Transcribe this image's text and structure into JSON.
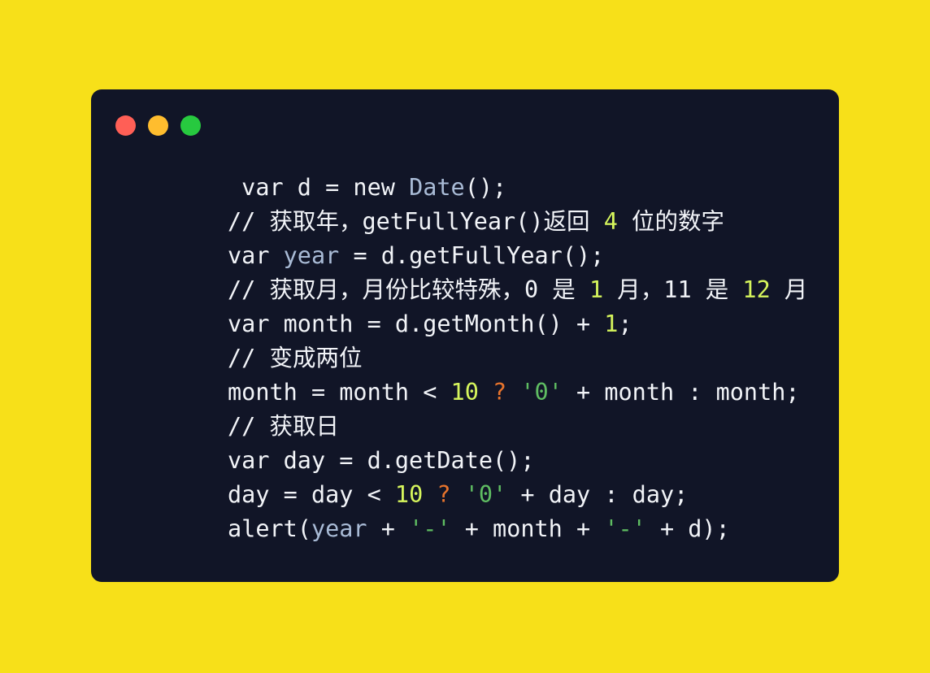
{
  "theme": {
    "page_background": "#f7e019",
    "card_background": "#111527",
    "text_default": "#f2f4f8",
    "color_type": "#a9bbd6",
    "color_variable": "#a9bbd6",
    "color_number": "#d6f55c",
    "color_string": "#5fbd62",
    "color_operator": "#e8742c",
    "color_comment": "#f2f4f8",
    "dot_close": "#ff5f56",
    "dot_minimize": "#ffbd2e",
    "dot_maximize": "#27c93f"
  },
  "window": {
    "controls": [
      {
        "name": "close",
        "color": "#ff5f56"
      },
      {
        "name": "minimize",
        "color": "#ffbd2e"
      },
      {
        "name": "maximize",
        "color": "#27c93f"
      }
    ]
  },
  "code": {
    "language": "javascript",
    "lines": [
      {
        "index": 1,
        "text": " var d = new Date();",
        "tokens": [
          {
            "t": " var d = new ",
            "c": "plain"
          },
          {
            "t": "Date",
            "c": "type"
          },
          {
            "t": "();",
            "c": "plain"
          }
        ]
      },
      {
        "index": 2,
        "text": "// 获取年，getFullYear()返回 4 位的数字",
        "tokens": [
          {
            "t": "// 获取年，getFullYear()返回 ",
            "c": "comment"
          },
          {
            "t": "4",
            "c": "number"
          },
          {
            "t": " 位的数字",
            "c": "comment"
          }
        ]
      },
      {
        "index": 3,
        "text": "var year = d.getFullYear();",
        "tokens": [
          {
            "t": "var ",
            "c": "plain"
          },
          {
            "t": "year",
            "c": "var"
          },
          {
            "t": " = d.getFullYear();",
            "c": "plain"
          }
        ]
      },
      {
        "index": 4,
        "text": "// 获取月，月份比较特殊，0 是 1 月，11 是 12 月",
        "tokens": [
          {
            "t": "// 获取月，月份比较特殊，0 是 ",
            "c": "comment"
          },
          {
            "t": "1",
            "c": "number"
          },
          {
            "t": " 月，11 是 ",
            "c": "comment"
          },
          {
            "t": "12",
            "c": "number"
          },
          {
            "t": " 月",
            "c": "comment"
          }
        ]
      },
      {
        "index": 5,
        "text": "var month = d.getMonth() + 1;",
        "tokens": [
          {
            "t": "var month = d.getMonth() + ",
            "c": "plain"
          },
          {
            "t": "1",
            "c": "number"
          },
          {
            "t": ";",
            "c": "plain"
          }
        ]
      },
      {
        "index": 6,
        "text": "// 变成两位",
        "tokens": [
          {
            "t": "// 变成两位",
            "c": "comment"
          }
        ]
      },
      {
        "index": 7,
        "text": "month = month < 10 ? '0' + month : month;",
        "tokens": [
          {
            "t": "month = month < ",
            "c": "plain"
          },
          {
            "t": "10",
            "c": "number"
          },
          {
            "t": " ",
            "c": "plain"
          },
          {
            "t": "?",
            "c": "operator"
          },
          {
            "t": " ",
            "c": "plain"
          },
          {
            "t": "'0'",
            "c": "string"
          },
          {
            "t": " + month : month;",
            "c": "plain"
          }
        ]
      },
      {
        "index": 8,
        "text": "// 获取日",
        "tokens": [
          {
            "t": "// 获取日",
            "c": "comment"
          }
        ]
      },
      {
        "index": 9,
        "text": "var day = d.getDate();",
        "tokens": [
          {
            "t": "var day = d.getDate();",
            "c": "plain"
          }
        ]
      },
      {
        "index": 10,
        "text": "day = day < 10 ? '0' + day : day;",
        "tokens": [
          {
            "t": "day = day < ",
            "c": "plain"
          },
          {
            "t": "10",
            "c": "number"
          },
          {
            "t": " ",
            "c": "plain"
          },
          {
            "t": "?",
            "c": "operator"
          },
          {
            "t": " ",
            "c": "plain"
          },
          {
            "t": "'0'",
            "c": "string"
          },
          {
            "t": " + day : day;",
            "c": "plain"
          }
        ]
      },
      {
        "index": 11,
        "text": "alert(year + '-' + month + '-' + d);",
        "tokens": [
          {
            "t": "alert(",
            "c": "plain"
          },
          {
            "t": "year",
            "c": "var"
          },
          {
            "t": " + ",
            "c": "plain"
          },
          {
            "t": "'-'",
            "c": "string"
          },
          {
            "t": " + month + ",
            "c": "plain"
          },
          {
            "t": "'-'",
            "c": "string"
          },
          {
            "t": " + d);",
            "c": "plain"
          }
        ]
      }
    ]
  }
}
